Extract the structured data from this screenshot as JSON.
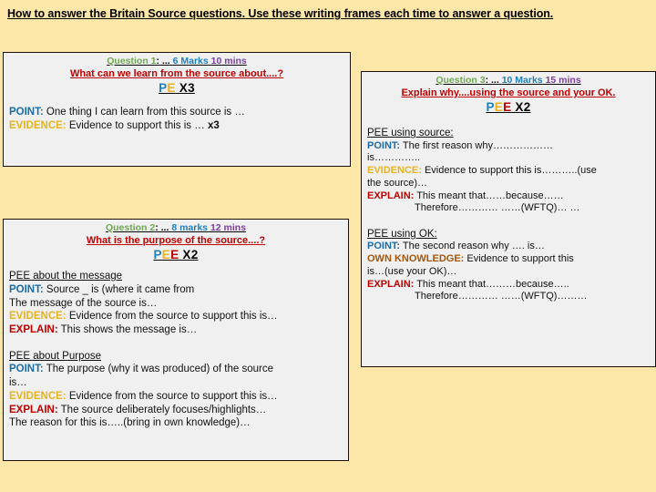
{
  "slide": {
    "title": "How to answer the Britain Source questions. Use these writing frames each time to answer a question.",
    "background_color": "#FCE7A8",
    "frame_background_color": "#F0F0F0",
    "frame_border_color": "#1A1008"
  },
  "colors": {
    "question_label": "#6FA84F",
    "marks": "#1F80C0",
    "time": "#7B3FA0",
    "subtitle": "#C00000",
    "point": "#1B6CA8",
    "evidence": "#E8B31E",
    "explain": "#C00000",
    "own_knowledge": "#A3560C"
  },
  "question1": {
    "label": "Question 1",
    "colon_dots": ": ...",
    "marks": "6 Marks",
    "time": "10 mins",
    "subtitle": "What can we learn from the source about....?",
    "pee_p": "P",
    "pee_e": "E",
    "pee_count": " X3",
    "point_label": "POINT:",
    "point_text": " One thing I can learn from this source is …",
    "evidence_label": "EVIDENCE:",
    "evidence_text": " Evidence to support this is …  ",
    "evidence_repeat": "x3"
  },
  "question2": {
    "label": "Question 2",
    "colon_dots": ": ...",
    "marks": "8 marks",
    "time": "12 mins",
    "subtitle": "What is the purpose of the source....?",
    "pee_p": "P",
    "pee_e1": "E",
    "pee_e2": "E",
    "pee_count": " X2",
    "section1_heading": "PEE about the message",
    "s1_point_label": "POINT:",
    "s1_point_text": " Source _ is (where it came from",
    "s1_message_line": "The message of the source is…",
    "s1_evidence_label": "EVIDENCE:",
    "s1_evidence_text": " Evidence from the source to support this is…",
    "s1_explain_label": "EXPLAIN:",
    "s1_explain_text": " This shows the message is…",
    "section2_heading": "PEE about Purpose",
    "s2_point_label": "POINT:",
    "s2_point_text": " The purpose (why it was produced) of the source",
    "s2_point_line2": "is…",
    "s2_evidence_label": "EVIDENCE:",
    "s2_evidence_text": " Evidence from the source to support this  is…",
    "s2_explain_label": "EXPLAIN:",
    "s2_explain_text": " The source deliberately focuses/highlights…",
    "s2_reason_line": "The reason for this is…..(bring in own knowledge)…"
  },
  "question3": {
    "label": "Question 3",
    "colon_dots": ": ...",
    "marks": "10 Marks",
    "time": "15 mins",
    "subtitle": "Explain why....using the source and your OK.",
    "pee_p": "P",
    "pee_e1": "E",
    "pee_e2": "E",
    "pee_count": " X2",
    "section1_heading": "PEE using source:",
    "s1_point_label": "POINT:",
    "s1_point_text": " The first reason why………………",
    "s1_point_line2": "is…………..",
    "s1_evidence_label": "EVIDENCE:",
    "s1_evidence_text": " Evidence to support this is………..(use",
    "s1_evidence_line2": "the source)…",
    "s1_explain_label": "EXPLAIN:",
    "s1_explain_text": " This meant that……because……",
    "s1_therefore": "Therefore………… ……(WFTQ)… …",
    "section2_heading": "PEE using OK:",
    "s2_point_label": "POINT:",
    "s2_point_text": " The second reason why …. is…",
    "s2_ok_label": "OWN KNOWLEDGE:",
    "s2_ok_text": " Evidence to support this",
    "s2_ok_line2": "is…(use your OK)…",
    "s2_explain_label": "EXPLAIN:",
    "s2_explain_text": " This meant that………because…..",
    "s2_therefore": "Therefore………… ……(WFTQ)………"
  }
}
